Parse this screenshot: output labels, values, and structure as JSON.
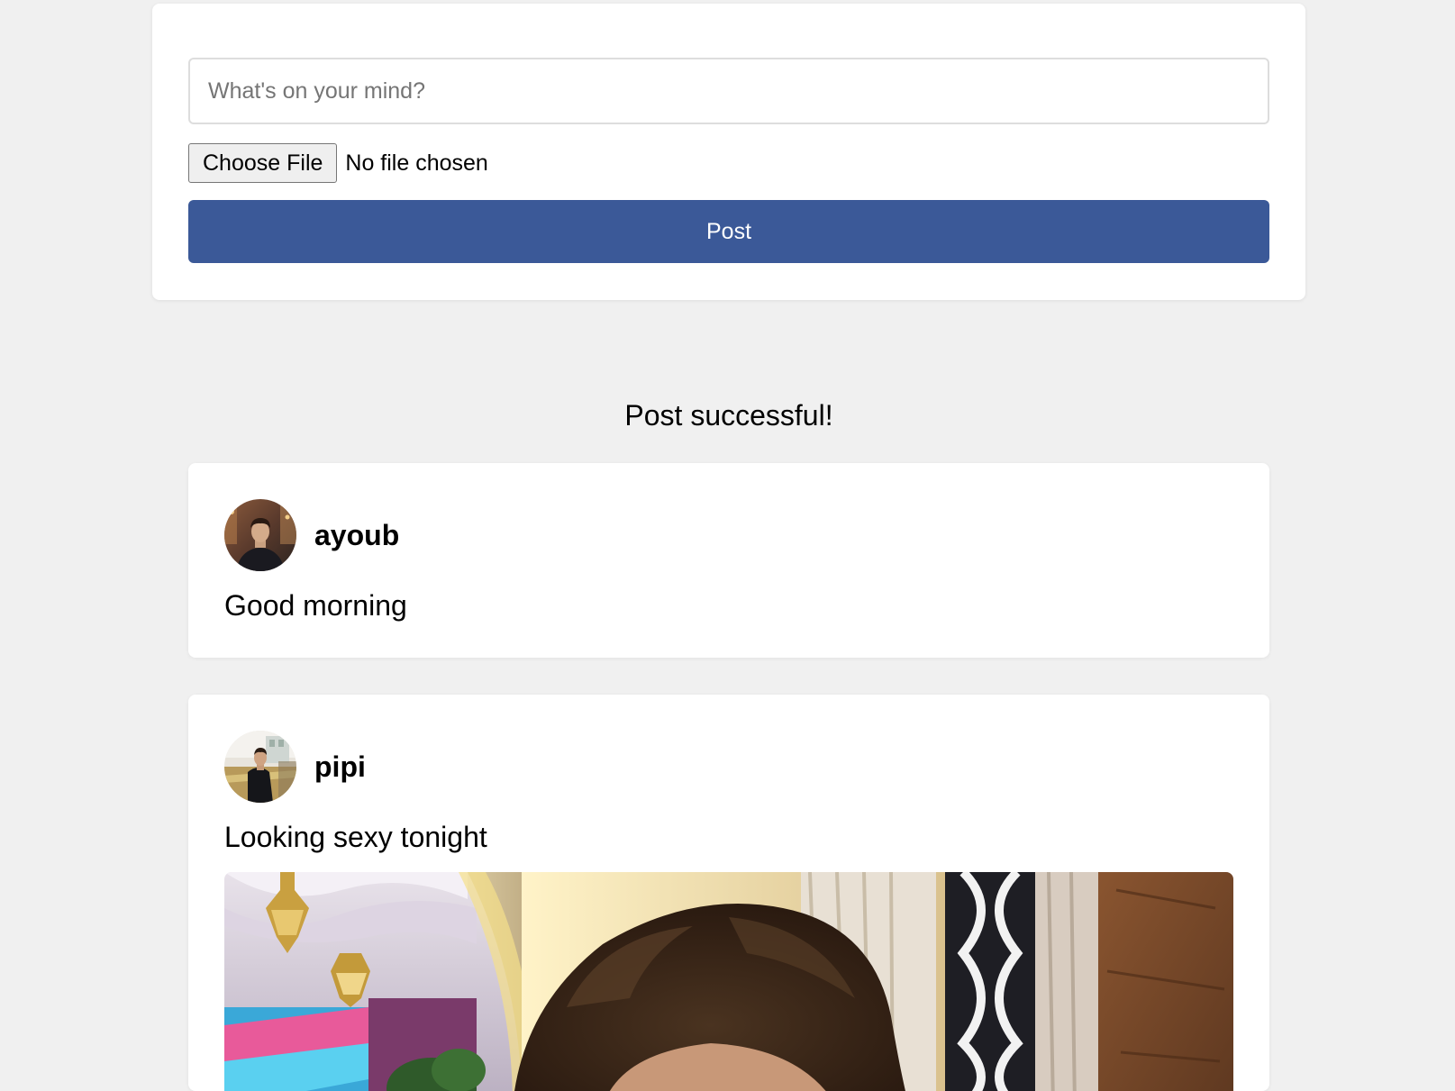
{
  "composer": {
    "placeholder": "What's on your mind?",
    "choose_file_label": "Choose File",
    "file_status": "No file chosen",
    "post_label": "Post"
  },
  "status_message": "Post successful!",
  "posts": [
    {
      "username": "ayoub",
      "text": "Good morning",
      "has_image": false
    },
    {
      "username": "pipi",
      "text": "Looking sexy tonight",
      "has_image": true
    }
  ],
  "colors": {
    "accent": "#3b5998",
    "background": "#f0f0f0",
    "card": "#ffffff"
  }
}
